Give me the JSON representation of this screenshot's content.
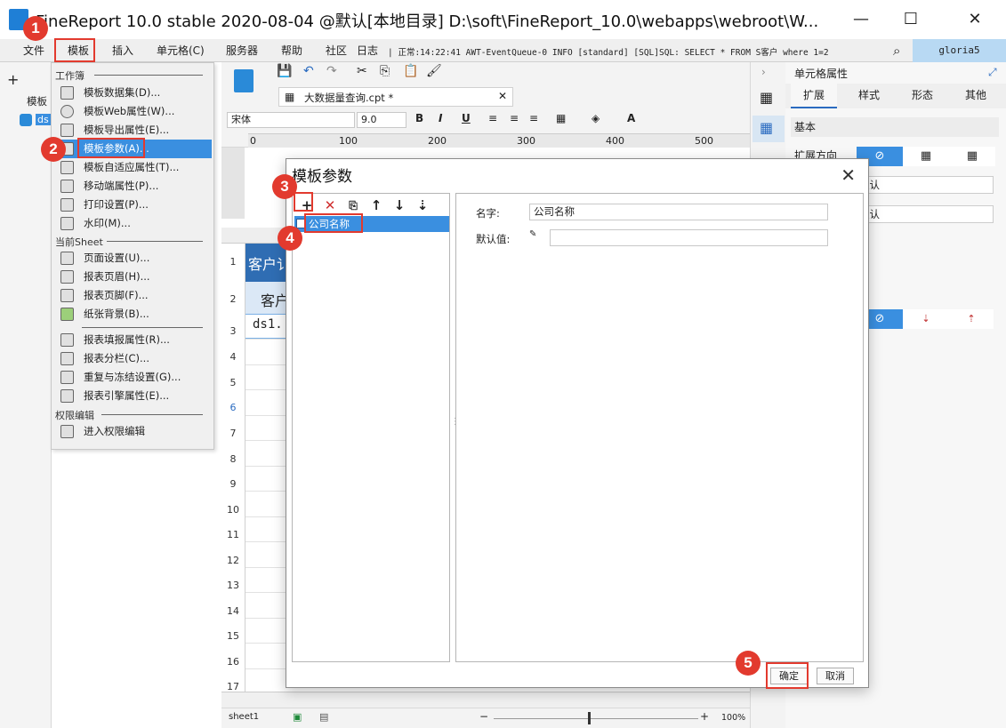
{
  "window": {
    "title": "FineReport 10.0 stable 2020-08-04 @默认[本地目录]    D:\\soft\\FineReport_10.0\\webapps\\webroot\\W...",
    "minimize": "—",
    "maximize": "☐",
    "close": "✕"
  },
  "menubar": {
    "items": [
      "文件",
      "模板",
      "插入",
      "单元格(C)",
      "服务器",
      "帮助",
      "社区",
      "日志"
    ],
    "log_text": "| 正常:14:22:41 AWT-EventQueue-0 INFO [standard] [SQL]SQL: SELECT * FROM S客户 where 1=2",
    "user": "gloria5"
  },
  "left_pane": {
    "label": "模板",
    "ds_label": "ds"
  },
  "dropdown": {
    "section_workbook": "工作簿",
    "section_sheet": "当前Sheet",
    "section_permission": "权限编辑",
    "items": [
      "模板数据集(D)...",
      "模板Web属性(W)...",
      "模板导出属性(E)...",
      "模板参数(A)...",
      "模板自适应属性(T)...",
      "移动端属性(P)...",
      "打印设置(P)...",
      "水印(M)...",
      "页面设置(U)...",
      "报表页眉(H)...",
      "报表页脚(F)...",
      "纸张背景(B)...",
      "报表填报属性(R)...",
      "报表分栏(C)...",
      "重复与冻结设置(G)...",
      "报表引擎属性(E)...",
      "进入权限编辑"
    ]
  },
  "editor": {
    "tab_name": "大数据量查询.cpt *",
    "font_name": "宋体",
    "font_size": "9.0",
    "ruler": [
      "0",
      "100",
      "200",
      "300",
      "400",
      "500"
    ],
    "cell_a1": "客户讠",
    "cell_a2": "客户",
    "cell_a3": "ds1.",
    "rows": [
      "1",
      "2",
      "3",
      "4",
      "5",
      "6",
      "7",
      "8",
      "9",
      "10",
      "11",
      "12",
      "13",
      "14",
      "15",
      "16",
      "17"
    ],
    "sheet_tab": "sheet1",
    "zoom": "100%"
  },
  "right_panel": {
    "title": "单元格属性",
    "tabs": [
      "扩展",
      "样式",
      "形态",
      "其他"
    ],
    "section": "基本",
    "expand_direction": "扩展方向",
    "default1": "默认",
    "default2": "默认"
  },
  "dialog": {
    "title": "模板参数",
    "param_name": "公司名称",
    "name_label": "名字:",
    "name_value": "公司名称",
    "default_label": "默认值:",
    "default_value": "",
    "ok": "确定",
    "cancel": "取消"
  },
  "callouts": [
    "1",
    "2",
    "3",
    "4",
    "5"
  ],
  "colors": {
    "accent": "#3a8fe0",
    "callout": "#e23a2e",
    "header_blue": "#2f6db3"
  }
}
